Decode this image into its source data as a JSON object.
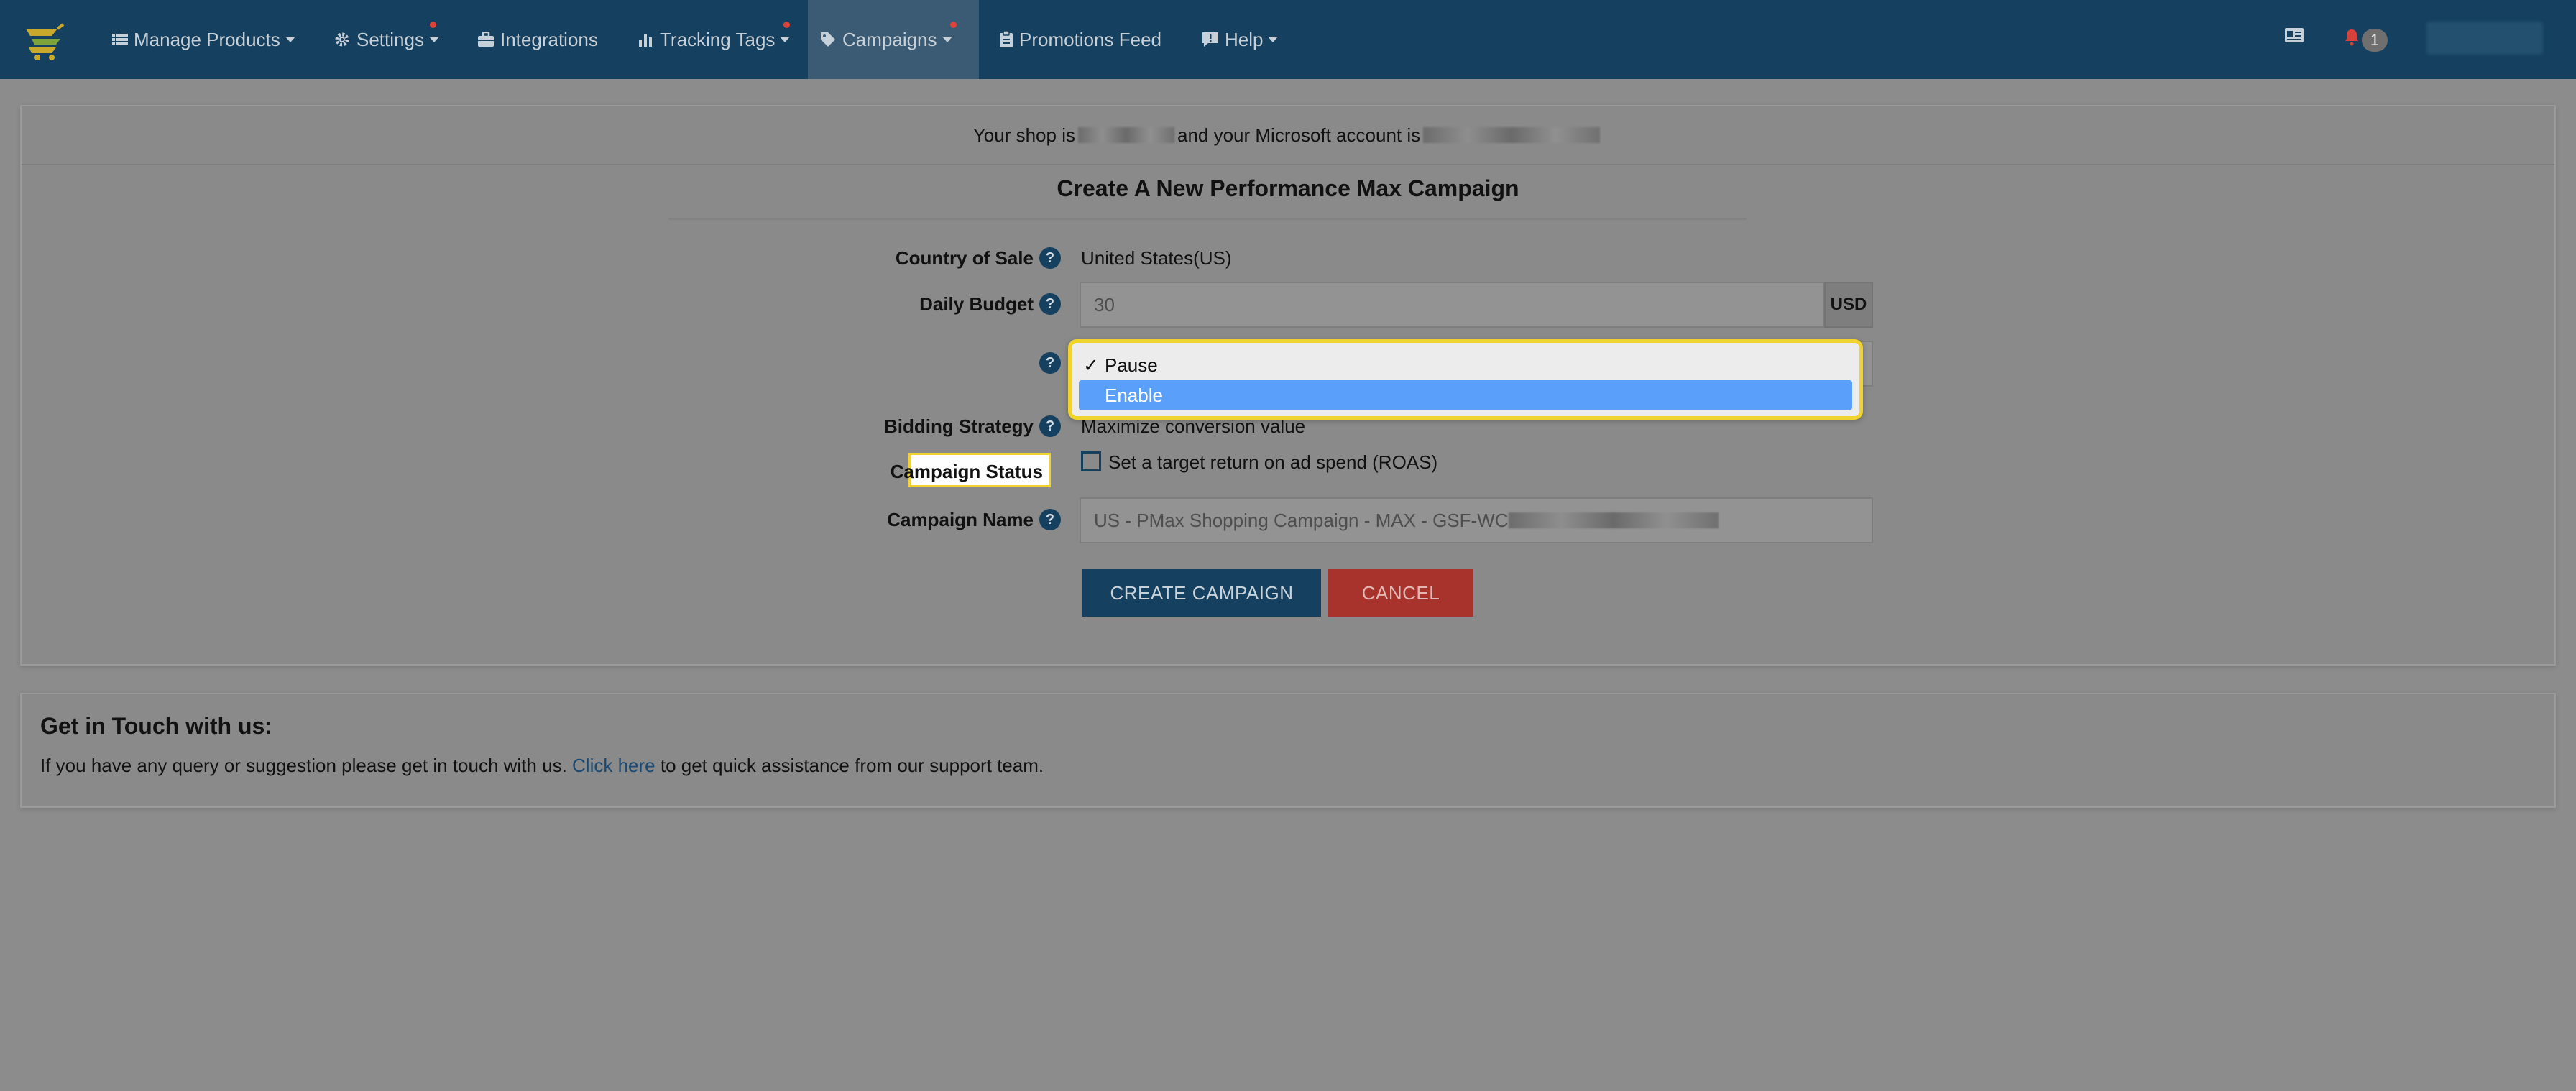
{
  "nav": {
    "items": [
      {
        "label": "Manage Products",
        "icon": "list-icon"
      },
      {
        "label": "Settings",
        "icon": "gear-icon"
      },
      {
        "label": "Integrations",
        "icon": "briefcase-icon"
      },
      {
        "label": "Tracking Tags",
        "icon": "bar-chart-icon"
      },
      {
        "label": "Campaigns",
        "icon": "tag-icon"
      },
      {
        "label": "Promotions Feed",
        "icon": "clipboard-icon"
      },
      {
        "label": "Help",
        "icon": "chat-icon"
      }
    ],
    "notification_count": "1",
    "brand_color": "#15405f"
  },
  "shop_line": {
    "prefix": "Your shop is",
    "middle": "and your Microsoft account is"
  },
  "form": {
    "title": "Create A New Performance Max Campaign",
    "country_label": "Country of Sale",
    "country_value": "United States(US)",
    "budget_label": "Daily Budget",
    "budget_value": "30",
    "budget_currency": "USD",
    "status_label": "Campaign Status",
    "status_options": [
      "Pause",
      "Enable"
    ],
    "status_selected": "Pause",
    "status_highlighted": "Enable",
    "bidding_label": "Bidding Strategy",
    "bidding_value": "Maximize conversion value",
    "roas_label": "Set a target return on ad spend (ROAS)",
    "name_label": "Campaign Name",
    "name_value": "US - PMax Shopping Campaign - MAX - GSF-WC",
    "help_glyph": "?",
    "check_glyph": "✓"
  },
  "buttons": {
    "create": "CREATE CAMPAIGN",
    "cancel": "CANCEL"
  },
  "touch": {
    "title": "Get in Touch with us:",
    "text_before": "If you have any query or suggestion please get in touch with us.",
    "link": "Click here",
    "text_after": "to get quick assistance from our support team."
  }
}
